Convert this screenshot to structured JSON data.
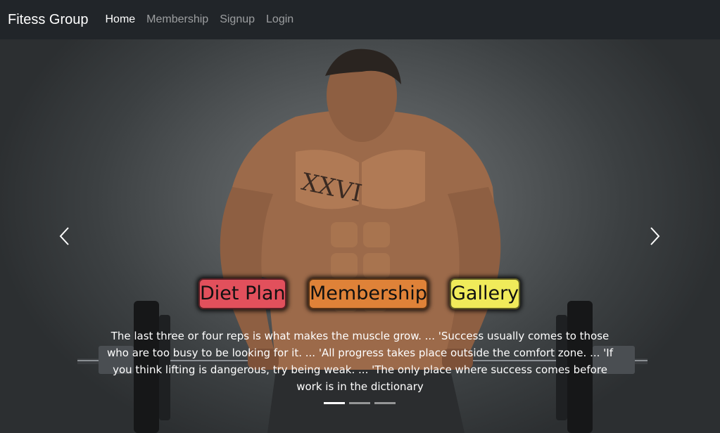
{
  "navbar": {
    "brand": "Fitess Group",
    "links": [
      {
        "label": "Home",
        "active": true
      },
      {
        "label": "Membership",
        "active": false
      },
      {
        "label": "Signup",
        "active": false
      },
      {
        "label": "Login",
        "active": false
      }
    ]
  },
  "carousel": {
    "prev_icon": "chevron-left-icon",
    "next_icon": "chevron-right-icon",
    "buttons": {
      "diet": "Diet Plan",
      "membership": "Membership",
      "gallery": "Gallery"
    },
    "caption": "The last three or four reps is what makes the muscle grow. ... 'Success usually comes to those who are too busy to be looking for it. ... 'All progress takes place outside the comfort zone. ... 'If you think lifting is dangerous, try being weak. ... 'The only place where success comes before work is in the dictionary",
    "indicators": [
      true,
      false,
      false
    ]
  },
  "colors": {
    "navbar": "#212529",
    "diet": "#e2505c",
    "membership": "#df8238",
    "gallery": "#f0eb5a"
  }
}
